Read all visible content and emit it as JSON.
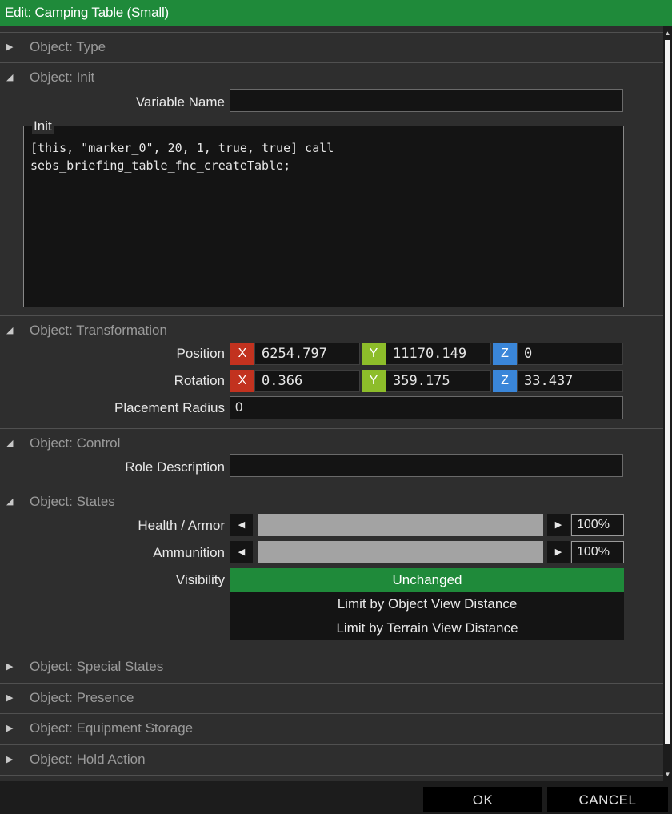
{
  "window": {
    "title": "Edit: Camping Table (Small)"
  },
  "sections": {
    "type": "Object: Type",
    "init": "Object: Init",
    "transformation": "Object: Transformation",
    "control": "Object: Control",
    "states": "Object: States",
    "special_states": "Object: Special States",
    "presence": "Object: Presence",
    "equipment_storage": "Object: Equipment Storage",
    "hold_action": "Object: Hold Action"
  },
  "init": {
    "variable_name_label": "Variable Name",
    "variable_name_value": "",
    "init_label": "Init",
    "code": "[this, \"marker_0\", 20, 1, true, true] call\nsebs_briefing_table_fnc_createTable;"
  },
  "transformation": {
    "position_label": "Position",
    "rotation_label": "Rotation",
    "placement_radius_label": "Placement Radius",
    "axis_x": "X",
    "axis_y": "Y",
    "axis_z": "Z",
    "position": {
      "x": "6254.797",
      "y": "11170.149",
      "z": "0"
    },
    "rotation": {
      "x": "0.366",
      "y": "359.175",
      "z": "33.437"
    },
    "placement_radius": "0"
  },
  "control": {
    "role_description_label": "Role Description",
    "role_description_value": ""
  },
  "states": {
    "health_label": "Health / Armor",
    "health_value": "100%",
    "health_fraction": 1.0,
    "ammunition_label": "Ammunition",
    "ammunition_value": "100%",
    "ammunition_fraction": 1.0,
    "visibility_label": "Visibility",
    "visibility_options": [
      "Unchanged",
      "Limit by Object View Distance",
      "Limit by Terrain View Distance"
    ],
    "visibility_selected": "Unchanged"
  },
  "footer": {
    "ok": "OK",
    "cancel": "CANCEL"
  },
  "icons": {
    "collapsed": "triangle-right-icon",
    "expanded": "triangle-down-icon",
    "slider_left": "triangle-left-icon",
    "slider_right": "triangle-right-icon"
  },
  "colors": {
    "accent_green": "#1f8a3a",
    "axis_x": "#c2321f",
    "axis_y": "#8dbd2a",
    "axis_z": "#3a86d9"
  }
}
